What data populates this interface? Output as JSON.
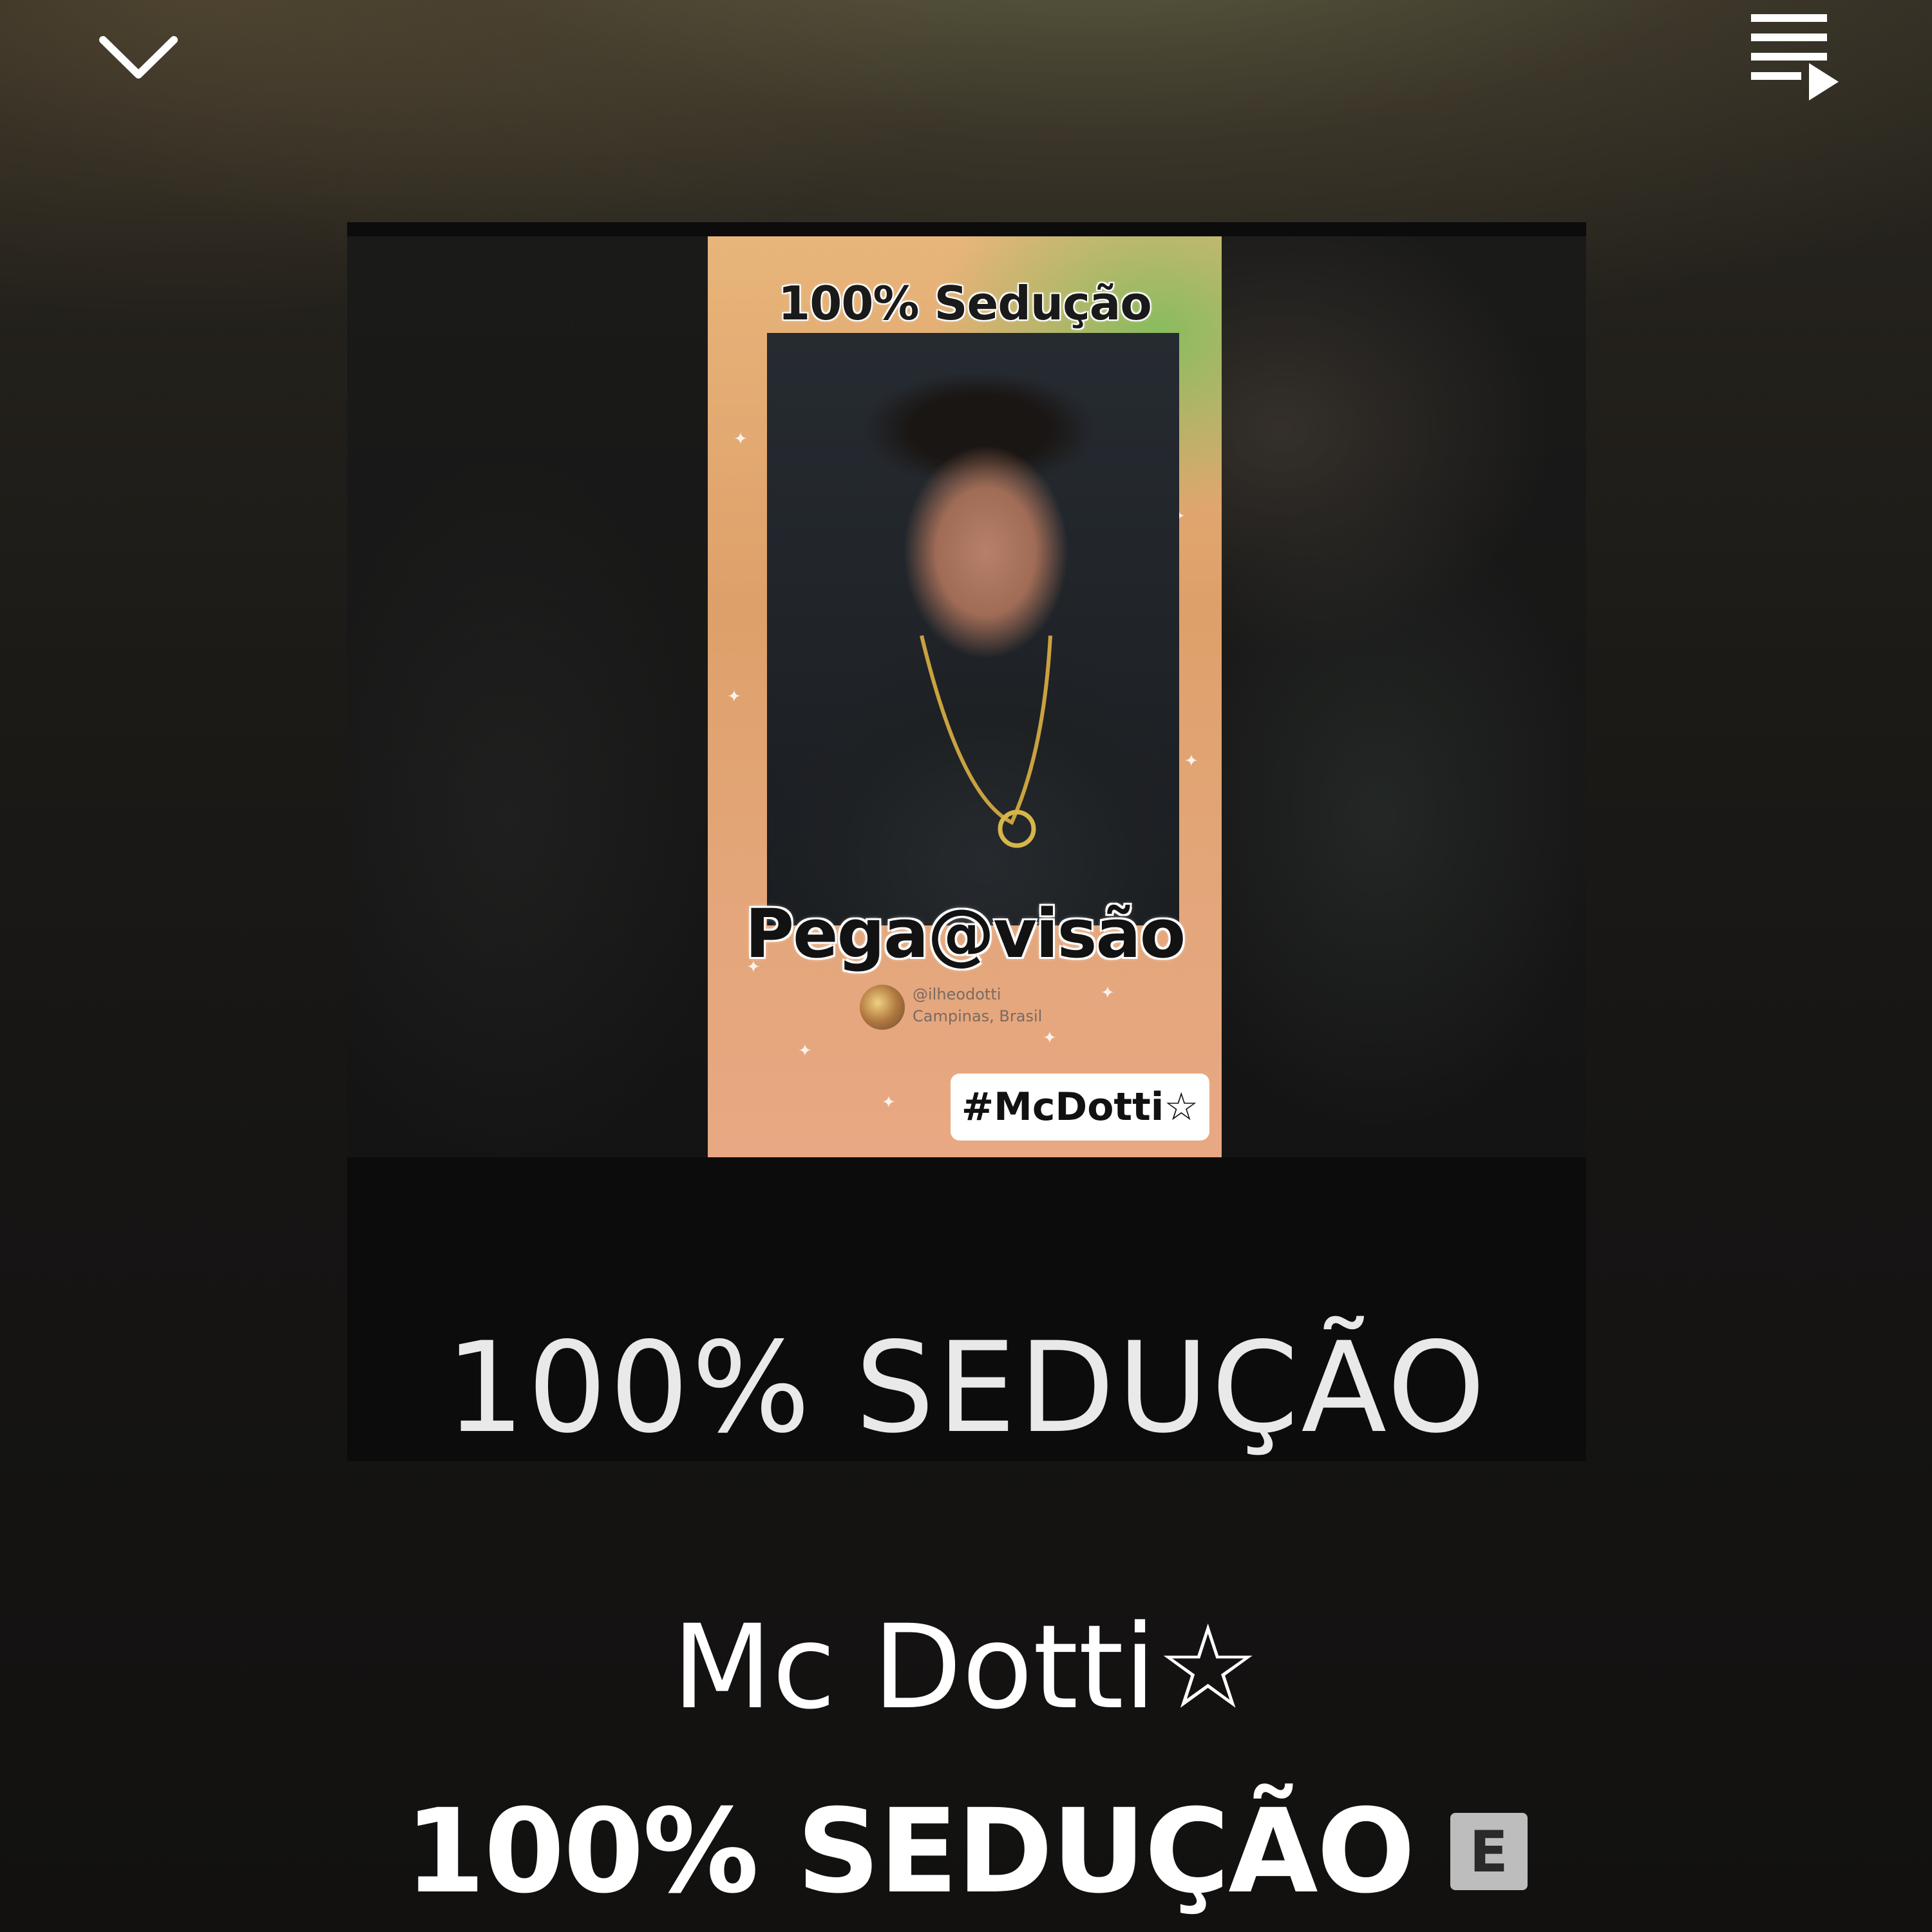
{
  "header": {
    "collapse_icon": "chevron-down-icon",
    "queue_icon": "queue-playlist-icon"
  },
  "album_art": {
    "poster_title": "100% Sedução",
    "poster_handle": "Pega@visão",
    "poster_ig_user": "@ilheodotti",
    "poster_ig_location": "Campinas, Brasil",
    "poster_tag": "#McDotti☆",
    "caption": "100% SEDUÇÃO"
  },
  "track": {
    "artist": "Mc Dotti☆",
    "title": "100% SEDUÇÃO",
    "explicit_label": "E"
  },
  "colors": {
    "text_primary": "#ffffff",
    "explicit_bg": "#bdbdbd",
    "background": "#121110"
  }
}
